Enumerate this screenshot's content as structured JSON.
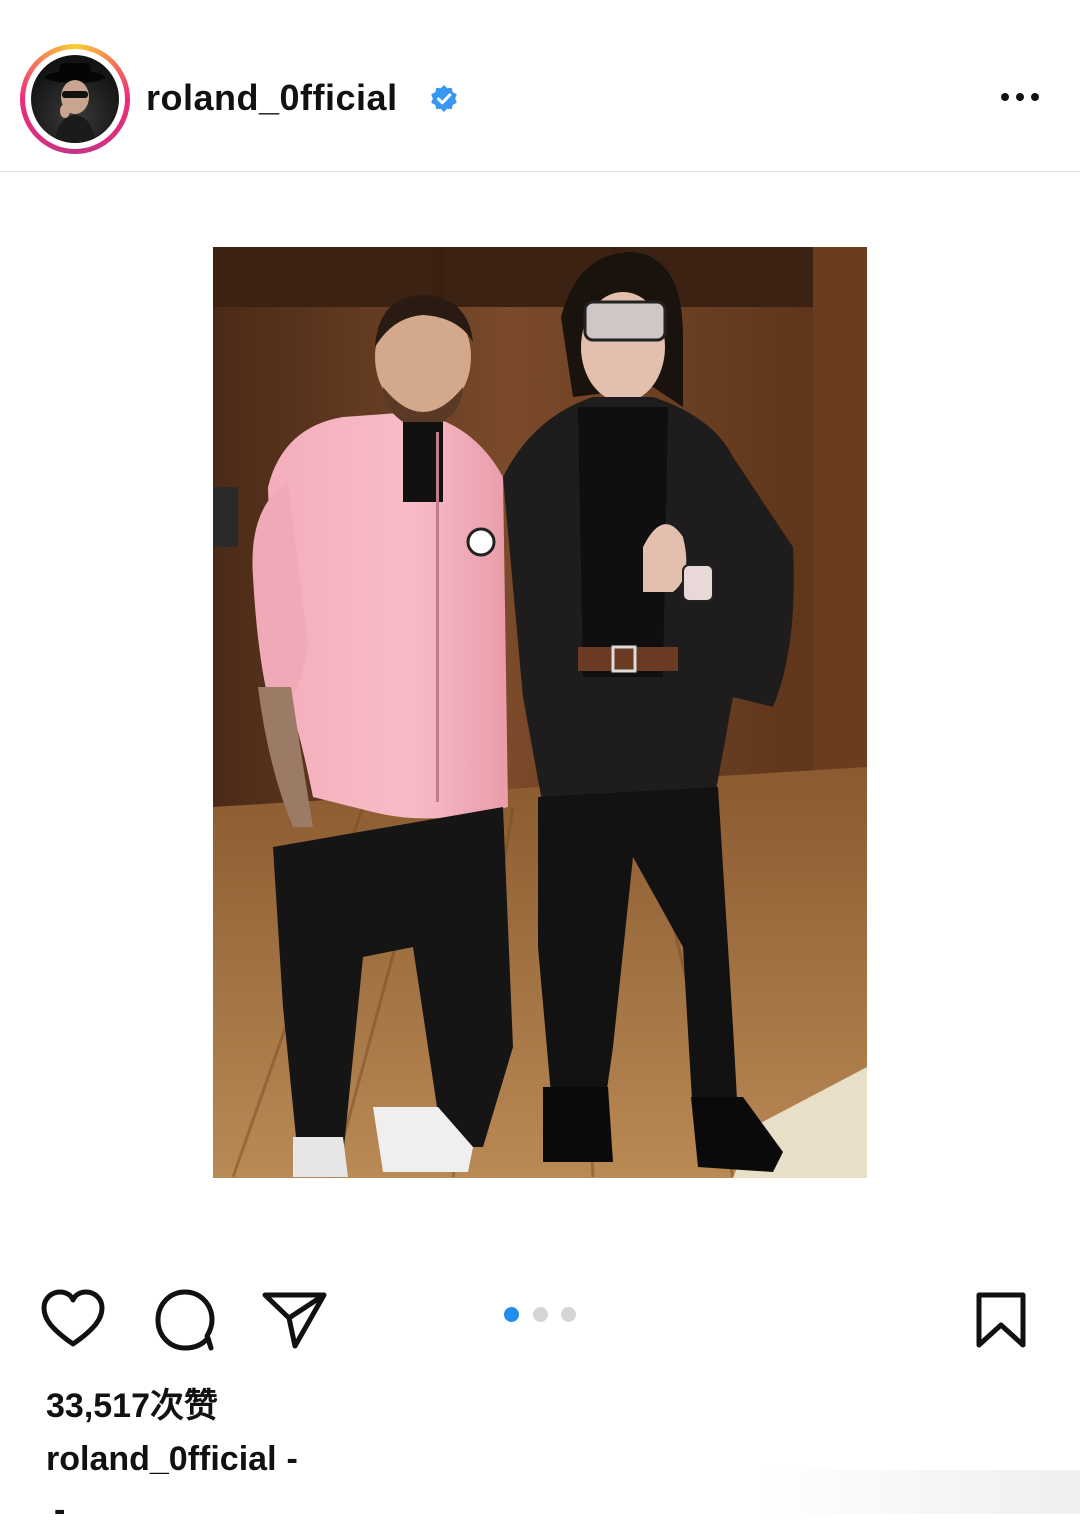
{
  "post": {
    "username": "roland_0fficial",
    "verified": true,
    "avatar_icon": "profile-avatar",
    "more_icon": "more-options-icon"
  },
  "carousel": {
    "total": 3,
    "active_index": 0
  },
  "actions": {
    "like_icon": "heart-icon",
    "comment_icon": "comment-icon",
    "share_icon": "send-icon",
    "save_icon": "bookmark-icon"
  },
  "stats": {
    "likes_count": "33,517",
    "likes_unit": "次赞"
  },
  "caption": {
    "username": "roland_0fficial",
    "text": "-",
    "second_line": "-"
  },
  "colors": {
    "verified_blue": "#3897f0",
    "active_dot": "#1f8ef1",
    "inactive_dot": "#d5d5d5",
    "story_ring": [
      "#f9ce34",
      "#ee2a7b",
      "#c13584"
    ]
  }
}
